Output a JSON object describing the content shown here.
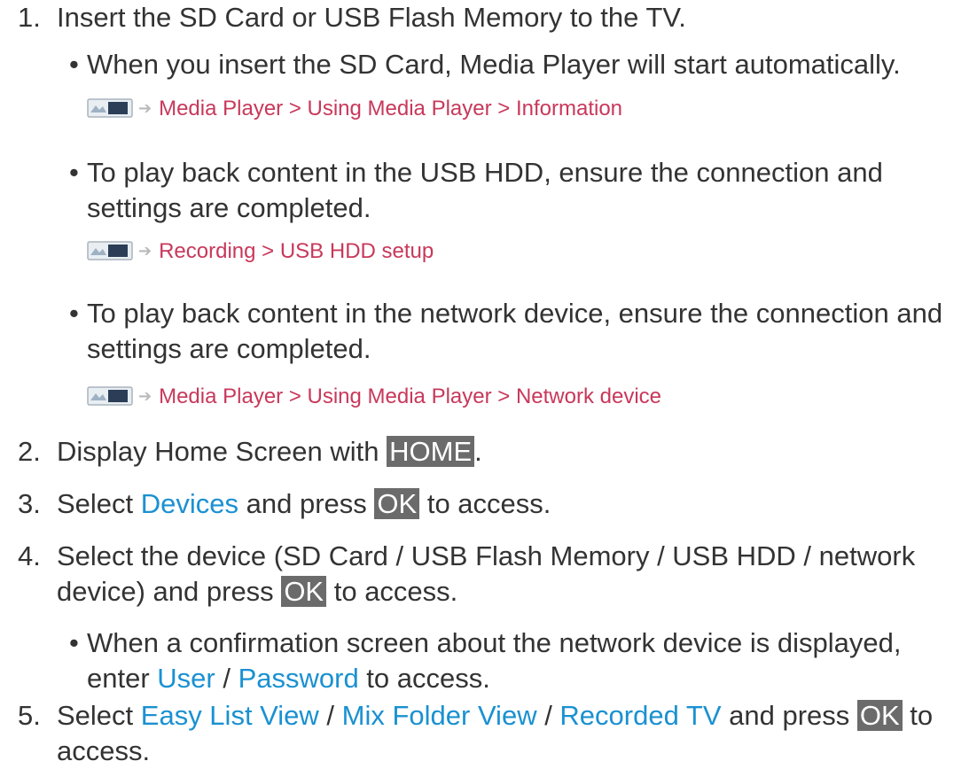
{
  "step1": {
    "num": "1.",
    "text": "Insert the SD Card or USB Flash Memory to the TV.",
    "bullet1": "When you insert the SD Card, Media Player will start automatically.",
    "ref1": "Media Player > Using Media Player > Information",
    "bullet2_line1": "To play back content in the USB HDD, ensure the connection and",
    "bullet2_line2": "settings are completed.",
    "ref2": "Recording > USB HDD setup",
    "bullet3_line1": "To play back content in the network device, ensure the connection and",
    "bullet3_line2": "settings are completed.",
    "ref3": "Media Player > Using Media Player > Network device"
  },
  "step2": {
    "num": "2.",
    "pre": "Display Home Screen with ",
    "key": "HOME",
    "post": "."
  },
  "step3": {
    "num": "3.",
    "pre": "Select ",
    "link": "Devices",
    "mid": " and press ",
    "key": "OK",
    "post": " to access."
  },
  "step4": {
    "num": "4.",
    "line1": "Select the device (SD Card / USB Flash Memory / USB HDD / network",
    "line2_pre": "device) and press ",
    "key": "OK",
    "line2_post": " to access.",
    "bullet_line1": "When a confirmation screen about the network device is displayed,",
    "bullet_pre": "enter ",
    "link1": "User",
    "sep": " / ",
    "link2": "Password",
    "bullet_post": " to access."
  },
  "step5": {
    "num": "5.",
    "pre": "Select ",
    "link1": "Easy List View",
    "sep1": " / ",
    "link2": "Mix Folder View",
    "sep2": " / ",
    "link3": "Recorded TV",
    "mid": " and press ",
    "key": "OK",
    "post": " to",
    "line2": "access."
  },
  "icons": {
    "tv_icon": "tv-screen-icon",
    "arrow": "arrow-right-icon"
  },
  "colors": {
    "link": "#1a91d1",
    "reference": "#c8385a",
    "key_bg": "#6b6b6b",
    "text": "#333333"
  }
}
